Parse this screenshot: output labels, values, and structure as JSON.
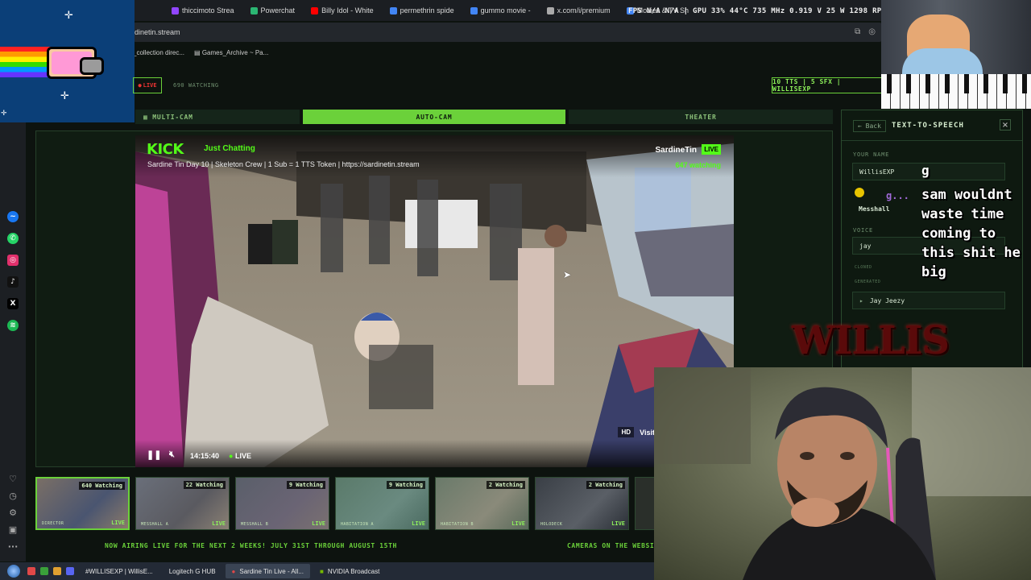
{
  "browser": {
    "tabs": [
      {
        "label": "thiccimoto Strea",
        "color": "#9146ff"
      },
      {
        "label": "Powerchat",
        "color": "#2bb673"
      },
      {
        "label": "Billy Idol - White",
        "color": "#ff0000"
      },
      {
        "label": "permethrin spide",
        "color": "#4285f4"
      },
      {
        "label": "gummo movie -",
        "color": "#4285f4"
      },
      {
        "label": "x.com/i/premium",
        "color": "#aaaaaa"
      },
      {
        "label": "Movies & TV Sh",
        "color": "#4285f4"
      }
    ],
    "hud_text": "FPS N/A N/A | GPU 33% 44°C 735 MHz 0.919 V 25 W 1298 RPM",
    "url": "dinetin.stream",
    "bookmarks": [
      "_collection direc...",
      "Games_Archive ~ Pa..."
    ]
  },
  "site": {
    "live_pill": "LIVE",
    "watching_count": "690 WATCHING",
    "tts_pill": "10 TTS | 5 SFX | WILLISEXP",
    "view_tabs": [
      "MULTI-CAM",
      "AUTO-CAM",
      "THEATER"
    ]
  },
  "video": {
    "platform": "KICK",
    "category": "Just Chatting",
    "title": "Sardine Tin Day 10 | Skeleton Crew | 1 Sub = 1 TTS Token | https://sardinetin.stream",
    "channel": "SardineTin",
    "live_badge": "LIVE",
    "watching": "647 watching",
    "time": "14:15:40",
    "live_indicator": "LIVE",
    "hd_label": "HD",
    "visit_label": "Visit"
  },
  "thumbnails": [
    {
      "watching": "640 Watching",
      "label": "DIRECTOR",
      "live": "LIVE"
    },
    {
      "watching": "22 Watching",
      "label": "MESSHALL A",
      "live": "LIVE"
    },
    {
      "watching": "9 Watching",
      "label": "MESSHALL B",
      "live": "LIVE"
    },
    {
      "watching": "9 Watching",
      "label": "HABITATION A",
      "live": "LIVE"
    },
    {
      "watching": "2 Watching",
      "label": "HABITATION B",
      "live": "LIVE"
    },
    {
      "watching": "2 Watching",
      "label": "HOLODECK",
      "live": "LIVE"
    }
  ],
  "ticker": {
    "left": "NOW AIRING LIVE FOR THE NEXT 2 WEEKS! JULY 31ST THROUGH AUGUST 15TH",
    "right": "CAMERAS ON THE WEBSITE"
  },
  "tts": {
    "back": "← Back",
    "title": "TEXT-TO-SPEECH",
    "close": "×",
    "name_label": "YOUR NAME",
    "name_value": "WillisEXP",
    "room_value": "Messhall",
    "voice_label": "VOICE",
    "voice_value": "jay",
    "cloned_label": "CLONED",
    "generated_label": "GENERATED",
    "voice_option": "Jay Jeezy"
  },
  "chat": {
    "user": "g...",
    "first_line": "g",
    "message": "sam wouldnt waste time coming to this shit he big"
  },
  "watermark": "WILLIS",
  "taskbar": {
    "items": [
      {
        "label": "#WILLISEXP | WillisE...",
        "active": false
      },
      {
        "label": "Logitech G HUB",
        "active": false
      },
      {
        "label": "Sardine Tin Live - All...",
        "active": true
      },
      {
        "label": "NVIDIA Broadcast",
        "active": false
      }
    ]
  },
  "colors": {
    "accent_green": "#6bd13a",
    "kick_green": "#53fc18",
    "panel_bg": "#0e1910"
  }
}
